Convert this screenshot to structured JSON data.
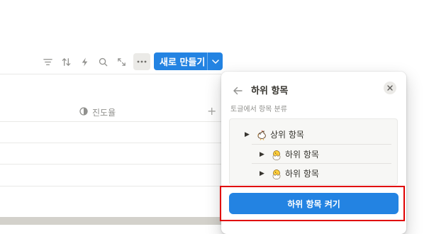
{
  "toolbar": {
    "icons": [
      "filter-icon",
      "sort-icon",
      "automation-icon",
      "search-icon",
      "expand-icon",
      "more-icon"
    ],
    "new_button_label": "새로 만들기"
  },
  "table": {
    "column_header": "진도율",
    "add_column": "+"
  },
  "popover": {
    "title": "하위 항목",
    "description": "토글에서 항목 분류",
    "tree": [
      {
        "label": "상위 항목",
        "level": 0,
        "emoji": "hen-icon"
      },
      {
        "label": "하위 항목",
        "level": 1,
        "emoji": "hatching-chick-icon"
      },
      {
        "label": "하위 항목",
        "level": 1,
        "emoji": "hatching-chick-icon"
      }
    ],
    "enable_button_label": "하위 항목 켜기"
  },
  "colors": {
    "accent": "#2383e2",
    "highlight": "#e00000"
  }
}
